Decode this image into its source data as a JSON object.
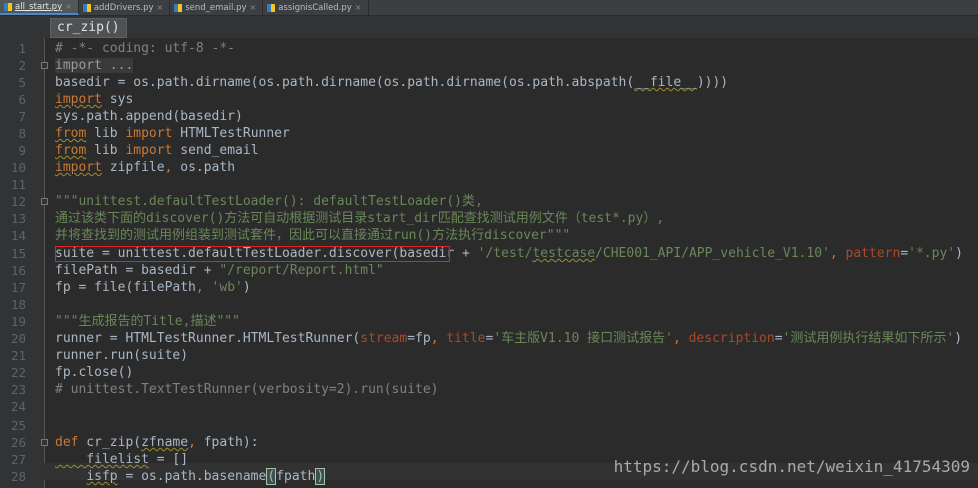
{
  "tabs": [
    {
      "label": "all_start.py",
      "active": true
    },
    {
      "label": "addDrivers.py",
      "active": false
    },
    {
      "label": "send_email.py",
      "active": false
    },
    {
      "label": "assignisCalled.py",
      "active": false
    }
  ],
  "breadcrumb": "cr_zip()",
  "line_numbers": [
    "1",
    "2",
    "5",
    "6",
    "7",
    "8",
    "9",
    "10",
    "11",
    "12",
    "13",
    "14",
    "15",
    "16",
    "17",
    "18",
    "19",
    "20",
    "21",
    "22",
    "23",
    "24",
    "25",
    "26",
    "27",
    "28"
  ],
  "code": {
    "l1": "# -*- coding: utf-8 -*-",
    "l2": "import ...",
    "l5_a": "basedir = os.path.dirname(os.path.dirname(os.path.dirname(os.path.abspath(",
    "l5_b": "__file__",
    "l5_c": "))))",
    "l6_kw": "import",
    "l6_rest": " sys",
    "l7": "sys.path.append(basedir)",
    "l8_kw": "from",
    "l8_mid": " lib ",
    "l8_kw2": "import",
    "l8_rest": " HTMLTestRunner",
    "l9_kw": "from",
    "l9_mid": " lib ",
    "l9_kw2": "import",
    "l9_rest": " send_email",
    "l10_kw": "import",
    "l10_mid": " zipfile",
    "l10_comma": ",",
    "l10_rest": " os.path",
    "l12": "\"\"\"unittest.defaultTestLoader(): defaultTestLoader()类,",
    "l13": "通过该类下面的discover()方法可自动根据测试目录start_dir匹配查找测试用例文件（test*.py）,",
    "l14": "并将查找到的测试用例组装到测试套件，因此可以直接通过run()方法执行discover\"\"\"",
    "l15_a": "suite = unittest.defaultTestLoader.discover(basedir + ",
    "l15_s1": "'/test/",
    "l15_s2": "testcase",
    "l15_s3": "/CHE001_API/APP_vehicle_V1.10'",
    "l15_comma": ", ",
    "l15_p": "pattern",
    "l15_eq": "=",
    "l15_s4": "'*.py'",
    "l15_end": ")",
    "l16_a": "filePath = basedir + ",
    "l16_s": "\"/report/Report.html\"",
    "l17_a": "fp = file(filePath",
    "l17_comma": ", ",
    "l17_s": "'wb'",
    "l17_end": ")",
    "l19": "\"\"\"生成报告的Title,描述\"\"\"",
    "l20_a": "runner = HTMLTestRunner.HTMLTestRunner(",
    "l20_p1": "stream",
    "l20_b": "=fp",
    "l20_c1": ", ",
    "l20_p2": "title",
    "l20_eq": "=",
    "l20_s1": "'车主版V1.10 接口测试报告'",
    "l20_c2": ", ",
    "l20_p3": "description",
    "l20_eq2": "=",
    "l20_s2": "'测试用例执行结果如下所示'",
    "l20_end": ")",
    "l21": "runner.run(suite)",
    "l22": "fp.close()",
    "l23": "# unittest.TextTestRunner(verbosity=2).run(suite)",
    "l26_kw": "def",
    "l26_name": " cr_zip(",
    "l26_a1": "zfname",
    "l26_c": ", ",
    "l26_a2": "fpath",
    "l26_end": "):",
    "l27_a": "    filelist",
    "l27_b": " = []",
    "l28_a": "    ",
    "l28_b": "isfp",
    "l28_c": " = os.path.basename",
    "l28_d": "(",
    "l28_e": "fpath",
    "l28_f": ")"
  },
  "watermark": "https://blog.csdn.net/weixin_41754309",
  "colors": {
    "keyword": "#cc7832",
    "string": "#6a8759",
    "comment": "#808080",
    "param": "#aa4926",
    "highlight_box": "#e52222"
  }
}
